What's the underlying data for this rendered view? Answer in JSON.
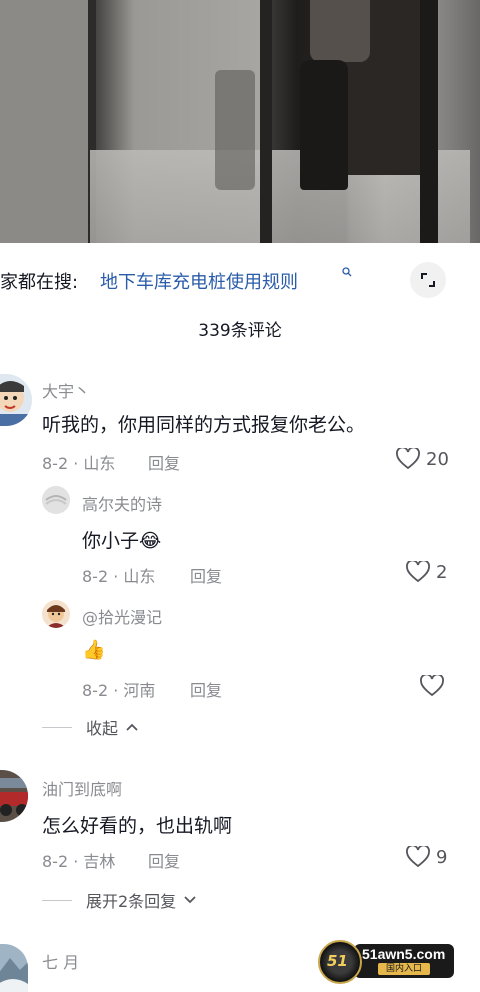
{
  "search": {
    "prefix": "家都在搜:",
    "query": "地下车库充电桩使用规则"
  },
  "comments_header": {
    "count_label": "339条评论"
  },
  "comments": [
    {
      "author": "大宇丶",
      "text": "听我的，你用同样的方式报复你老公。",
      "meta": "8-2 · 山东",
      "reply_label": "回复",
      "likes": "20",
      "replies": [
        {
          "author": "高尔夫的诗",
          "text": "你小子",
          "emoji": "😂",
          "meta": "8-2 · 山东",
          "reply_label": "回复",
          "likes": "2"
        },
        {
          "author": "@拾光漫记",
          "text": "",
          "emoji": "👍",
          "meta": "8-2 · 河南",
          "reply_label": "回复",
          "likes": ""
        }
      ],
      "collapse_label": "收起"
    },
    {
      "author": "油门到底啊",
      "text": "怎么好看的，也出轨啊",
      "meta": "8-2 · 吉林",
      "reply_label": "回复",
      "likes": "9",
      "expand_label": "展开2条回复"
    },
    {
      "author": "七 月"
    }
  ],
  "watermark": {
    "domain": "51awn5.com",
    "sub": "国内入口",
    "badge": "51"
  },
  "colors": {
    "link": "#2a5caa",
    "muted": "#8a8b91",
    "text": "#161823"
  }
}
